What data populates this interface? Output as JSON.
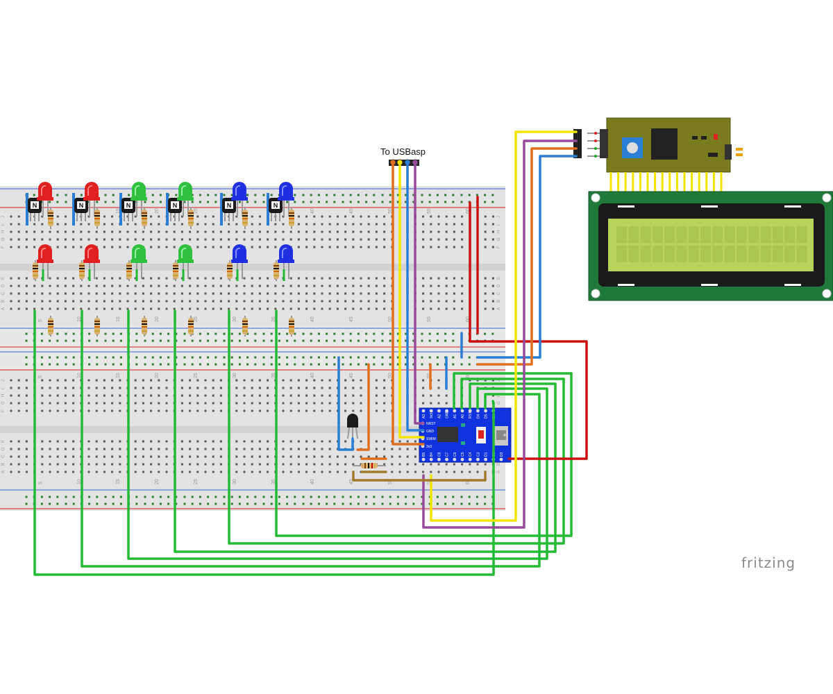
{
  "labels": {
    "usb_caption": "To USBasp",
    "brand": "fritzing"
  },
  "breadboard": {
    "column_numbers_top": [
      "5",
      "10",
      "15",
      "20",
      "25",
      "30",
      "35",
      "40",
      "45",
      "50",
      "55",
      "60"
    ],
    "column_numbers_bottom": [
      "5",
      "10",
      "15",
      "20",
      "25",
      "30",
      "35",
      "40",
      "45",
      "50",
      "55",
      "60"
    ],
    "row_letters_top": [
      "J",
      "I",
      "H",
      "G",
      "F",
      "E",
      "D",
      "C",
      "B",
      "A"
    ],
    "row_letters_bottom": [
      "J",
      "I",
      "H",
      "G",
      "F",
      "E",
      "D",
      "C",
      "B",
      "A"
    ]
  },
  "mcu_board": {
    "pins_top": [
      "A3",
      "3v3",
      "A2",
      "GND",
      "A1",
      "A0",
      "RST",
      "D4",
      "D5",
      "D6"
    ],
    "pins_bottom": [
      "B5",
      "B4",
      "C8",
      "C7",
      "C6",
      "C5",
      "C4",
      "C3",
      "D1",
      "D2",
      "D3"
    ],
    "pins_left": [
      "NRST",
      "GND",
      "SWIM",
      "3v3"
    ],
    "chip_label": "STM8"
  },
  "colors": {
    "wire_green": "#22bb33",
    "wire_red": "#cc1111",
    "wire_blue": "#2a7fd4",
    "wire_orange": "#e07020",
    "wire_yellow": "#f2e600",
    "wire_purple": "#9a4a9a",
    "wire_brown": "#a07a2a",
    "board_blue": "#1133dd",
    "lcd_green": "#1f7a3a",
    "lcd_screen": "#b7d35a",
    "i2c_board": "#7a7a1e"
  }
}
